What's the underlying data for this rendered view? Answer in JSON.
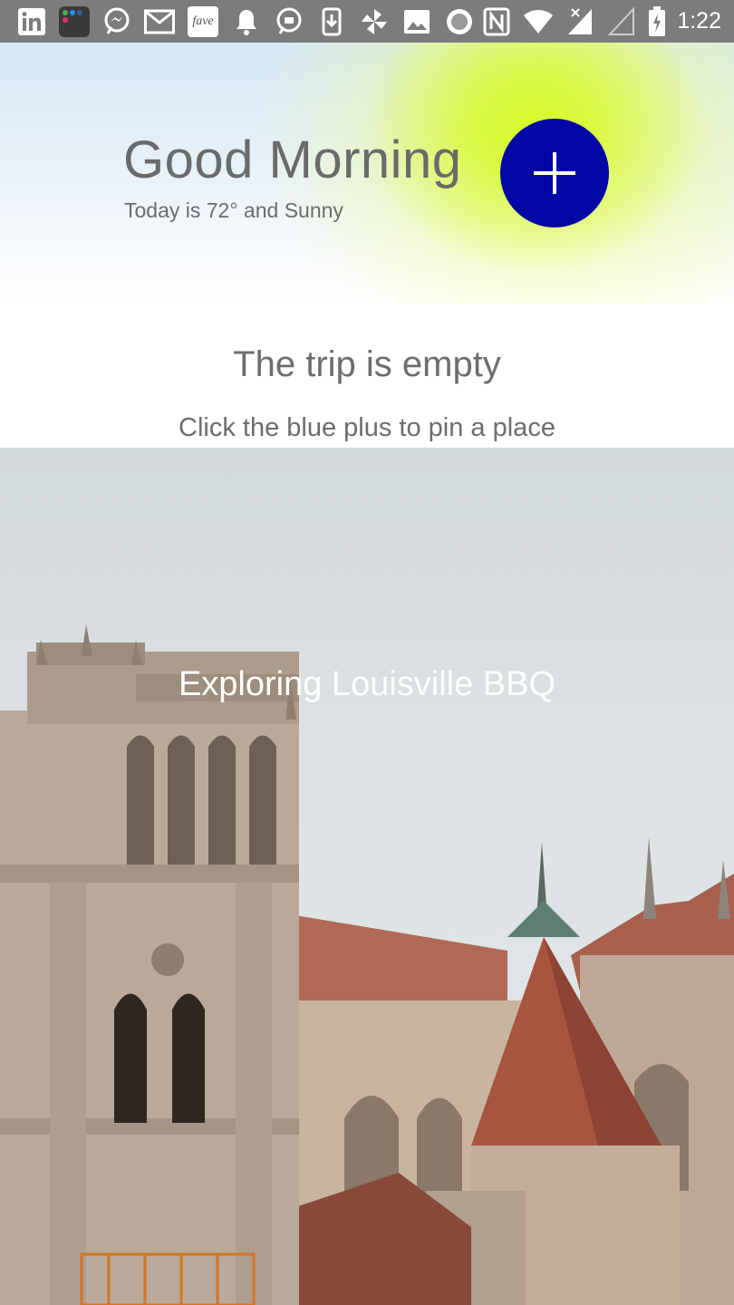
{
  "status_bar": {
    "time": "1:22",
    "left_icons": [
      "linkedin-icon",
      "app-folder-icon",
      "messenger-icon",
      "gmail-icon",
      "fave-icon",
      "notification-bell-icon",
      "messenger-icon",
      "download-icon",
      "pinwheel-icon",
      "image-icon",
      "record-icon"
    ],
    "right_icons": [
      "nfc-icon",
      "wifi-icon",
      "signal-icon",
      "signal-empty-icon",
      "battery-charging-icon"
    ],
    "fave_label": "fave"
  },
  "header": {
    "greeting": "Good Morning",
    "weather": "Today is 72° and Sunny",
    "accent_color": "#0007a5"
  },
  "empty_state": {
    "title": "The trip is empty",
    "subtitle": "Click the blue plus to pin a place"
  },
  "trip_card": {
    "title": "Exploring Louisville BBQ"
  }
}
